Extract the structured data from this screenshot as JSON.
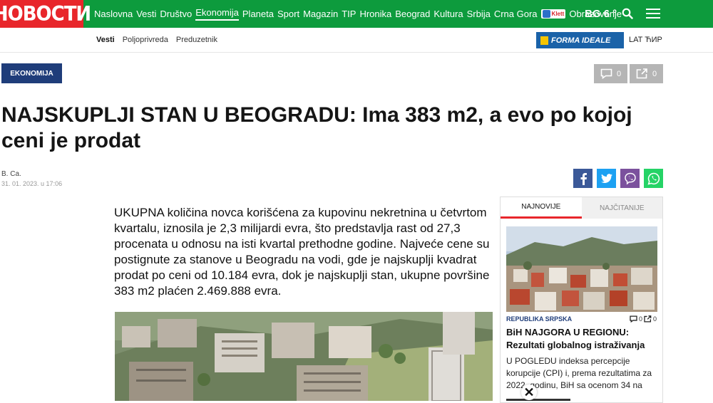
{
  "logo": {
    "text": "НОВОСТИ"
  },
  "nav": {
    "items": [
      "Naslovna",
      "Vesti",
      "Društvo",
      "Ekonomija",
      "Planeta",
      "Sport",
      "Magazin",
      "TIP",
      "Hronika",
      "Beograd",
      "Kultura",
      "Srbija",
      "Crna Gora"
    ],
    "active": "Ekonomija",
    "klett_label": "Klett",
    "last_item": "Obrazovanje"
  },
  "weather": "BG 6 °",
  "subnav": {
    "items": [
      "Vesti",
      "Poljoprivreda",
      "Preduzetnik"
    ]
  },
  "sponsor": {
    "text": "FORMA IDEALE",
    "color": "#1a62a8"
  },
  "language": "LAT ЋИР",
  "article": {
    "category": "EKONOMIJA",
    "comments": "0",
    "shares": "0",
    "title": "NAJSKUPLJI STAN U BEOGRADU: Ima 383 m2, a evo po kojoj ceni je prodat",
    "author": "B. Ca.",
    "date": "31. 01. 2023. u 17:06",
    "lead": "UKUPNA količina novca korišćena za kupovinu nekretnina u četvrtom kvartalu, iznosila je 2,3 milijardi evra, što predstavlja rast od 27,3 procenata u odnosu na isti kvartal prethodne godine. Najveće cene su postignute za stanove u Beogradu na vodi, gde je najskuplji kvadrat prodat po ceni od 10.184 evra, dok je najskuplji stan, ukupne površine 383 m2 plaćen 2.469.888 evra."
  },
  "sidebar": {
    "tabs": [
      "NAJNOVIJE",
      "NAJČITANIJE"
    ],
    "story": {
      "category": "REPUBLIKA SRPSKA",
      "comments": "0",
      "shares": "0",
      "title": "BiH NAJGORA U REGIONU: Rezultati globalnog istraživanja",
      "text": "U POGLEDU indeksa percepcije korupcije (CPI) i, prema rezultatima za 2022. godinu, BiH sa ocenom 34 na"
    }
  },
  "icons": {
    "close": "close-icon",
    "search": "search-icon",
    "menu": "hamburger-menu-icon"
  },
  "colors": {
    "brand_red": "#e8262b",
    "nav_green": "#0d9b3d",
    "category_blue": "#1f3d7a"
  }
}
